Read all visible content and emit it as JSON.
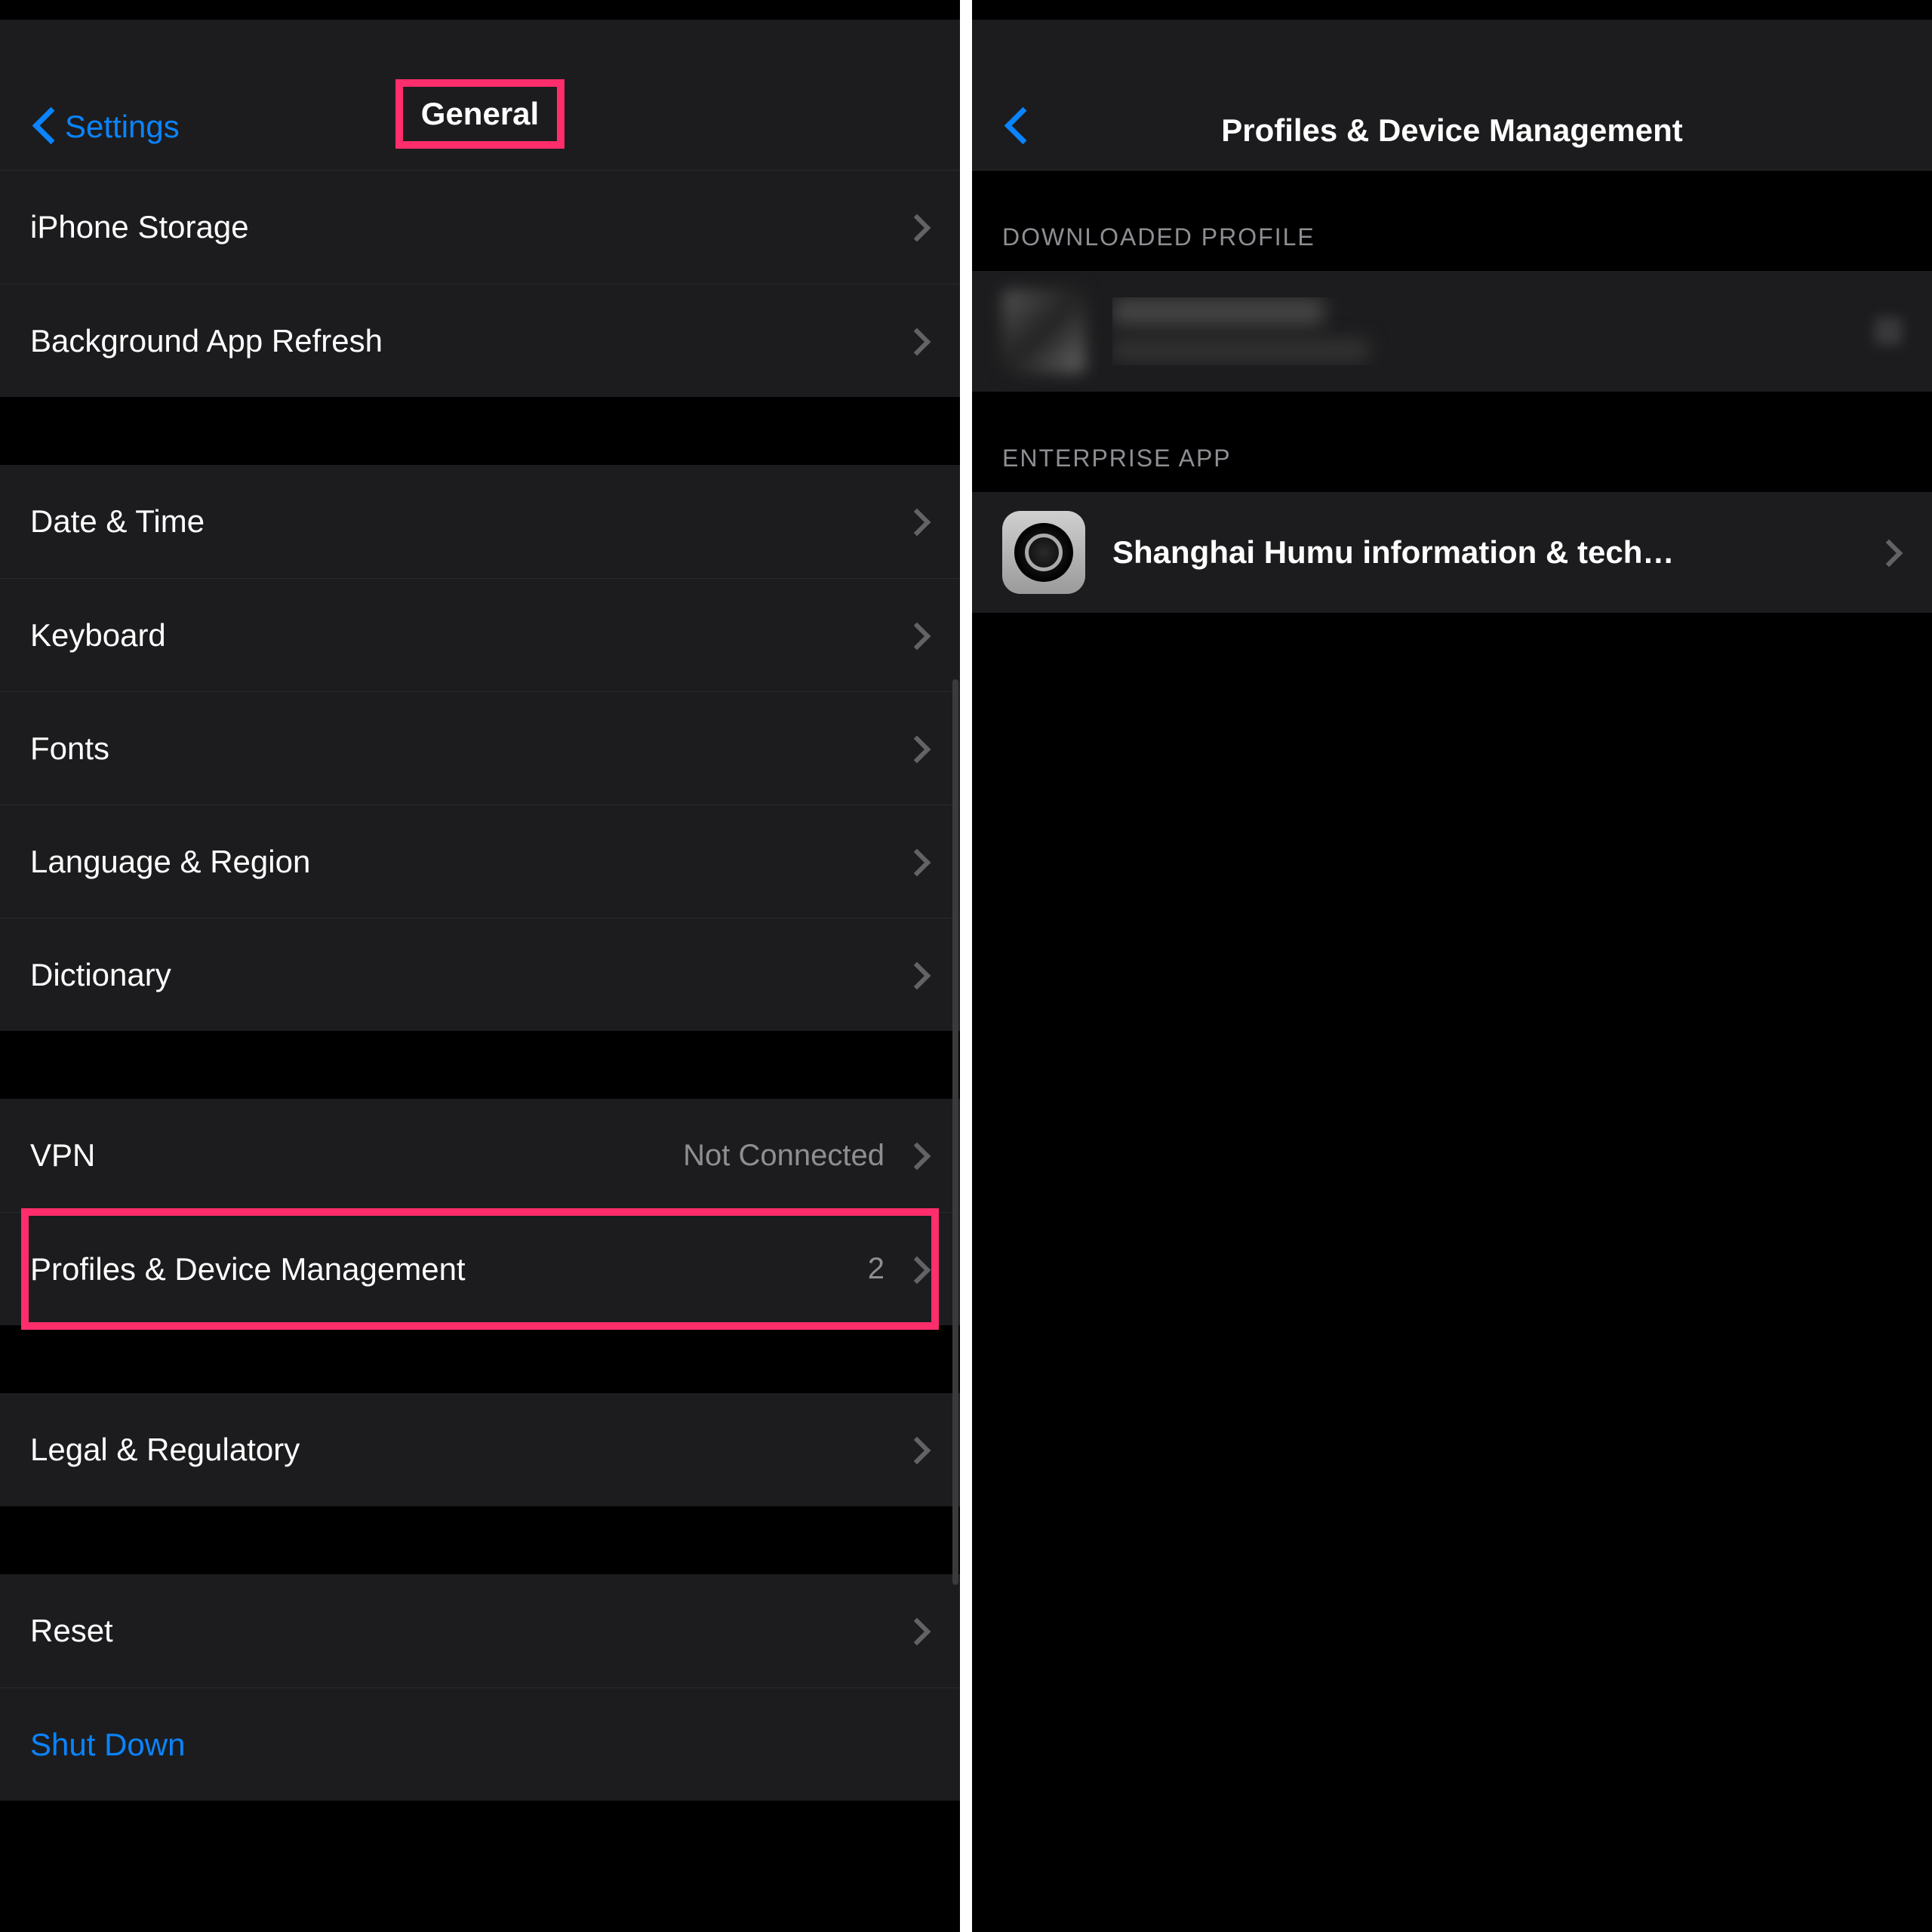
{
  "colors": {
    "highlight": "#ff2d6b",
    "link": "#0a84ff"
  },
  "left": {
    "back_label": "Settings",
    "title": "General",
    "groups": [
      {
        "rows": [
          {
            "label": "iPhone Storage",
            "name": "iphone-storage"
          },
          {
            "label": "Background App Refresh",
            "name": "background-app-refresh"
          }
        ]
      },
      {
        "rows": [
          {
            "label": "Date & Time",
            "name": "date-time"
          },
          {
            "label": "Keyboard",
            "name": "keyboard"
          },
          {
            "label": "Fonts",
            "name": "fonts"
          },
          {
            "label": "Language & Region",
            "name": "language-region"
          },
          {
            "label": "Dictionary",
            "name": "dictionary"
          }
        ]
      },
      {
        "rows": [
          {
            "label": "VPN",
            "value": "Not Connected",
            "name": "vpn"
          },
          {
            "label": "Profiles & Device Management",
            "value": "2",
            "name": "profiles-device-management",
            "highlighted": true
          }
        ]
      },
      {
        "rows": [
          {
            "label": "Legal & Regulatory",
            "name": "legal-regulatory"
          }
        ]
      },
      {
        "rows": [
          {
            "label": "Reset",
            "name": "reset"
          },
          {
            "label": "Shut Down",
            "name": "shut-down",
            "blue": true,
            "no_chevron": true
          }
        ]
      }
    ]
  },
  "right": {
    "title": "Profiles & Device Management",
    "section1_header": "DOWNLOADED PROFILE",
    "profile": {
      "title_redacted": "█████",
      "subtitle_redacted": "█████"
    },
    "section2_header": "ENTERPRISE APP",
    "enterprise": {
      "label": "Shanghai Humu information & tech…"
    }
  }
}
